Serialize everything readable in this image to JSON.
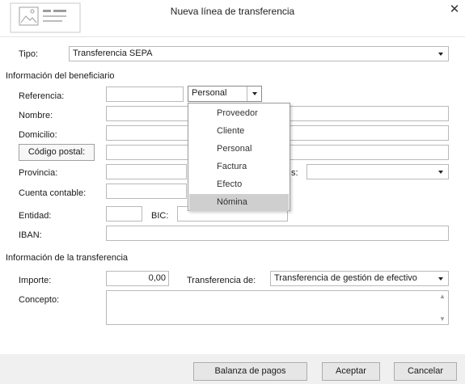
{
  "window": {
    "title": "Nueva línea de transferencia",
    "close_glyph": "✕",
    "header_icon": "document-form-icon"
  },
  "tipo": {
    "label": "Tipo:",
    "value": "Transferencia SEPA"
  },
  "beneficiario": {
    "section_title": "Información del beneficiario",
    "referencia_label": "Referencia:",
    "referencia_value": "",
    "referencia_type": "Personal",
    "nombre_label": "Nombre:",
    "domicilio_label": "Domicilio:",
    "codigo_postal_button": "Código postal:",
    "provincia_label": "Provincia:",
    "pais_label_partial": "s:",
    "cuenta_label": "Cuenta contable:",
    "entidad_label": "Entidad:",
    "bic_label": "BIC:",
    "iban_label": "IBAN:"
  },
  "referencia_dropdown": {
    "options": [
      "Proveedor",
      "Cliente",
      "Personal",
      "Factura",
      "Efecto",
      "Nómina"
    ],
    "highlighted": "Nómina"
  },
  "transferencia": {
    "section_title": "Información de la transferencia",
    "importe_label": "Importe:",
    "importe_value": "0,00",
    "transferencia_de_label": "Transferencia de:",
    "transferencia_de_value": "Transferencia de gestión de efectivo",
    "concepto_label": "Concepto:"
  },
  "footer": {
    "balanza_button": "Balanza de pagos",
    "aceptar_button": "Aceptar",
    "cancelar_button": "Cancelar"
  }
}
